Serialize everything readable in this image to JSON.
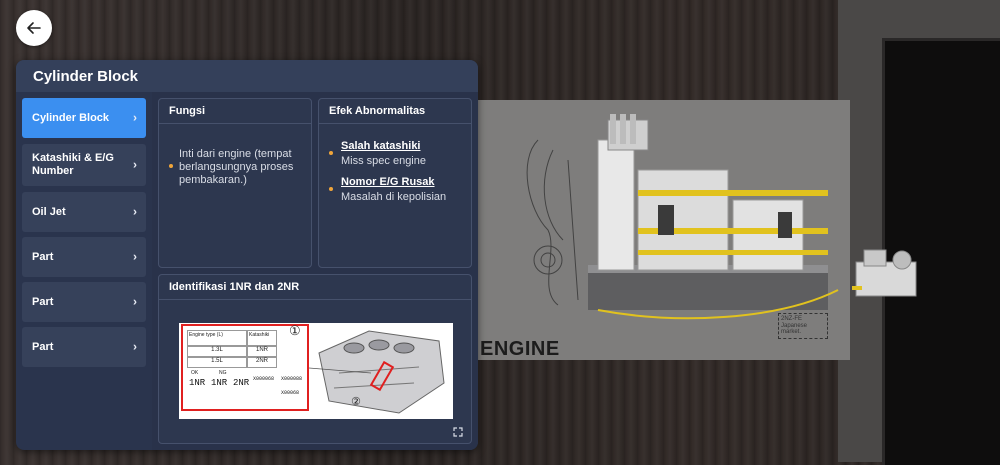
{
  "header": {
    "back_icon": "arrow-left-icon"
  },
  "panel": {
    "title": "Cylinder Block",
    "menu": [
      {
        "label": "Cylinder Block",
        "active": true
      },
      {
        "label": "Katashiki & E/G Number",
        "active": false
      },
      {
        "label": "Oil Jet",
        "active": false
      },
      {
        "label": "Part",
        "active": false
      },
      {
        "label": "Part",
        "active": false
      },
      {
        "label": "Part",
        "active": false
      }
    ],
    "fungsi": {
      "title": "Fungsi",
      "text": "Inti dari engine (tempat berlangsungnya proses pembakaran.)"
    },
    "efek": {
      "title": "Efek Abnormalitas",
      "items": [
        {
          "heading": "Salah katashiki",
          "desc": "Miss spec engine"
        },
        {
          "heading": "Nomor E/G Rusak",
          "desc": "Masalah di kepolisian"
        }
      ]
    },
    "identifikasi": {
      "title": "Identifikasi 1NR dan 2NR",
      "table": {
        "col1": "Engine type (L)",
        "col2": "Katashiki",
        "rows": [
          [
            "1.3L",
            "1NR"
          ],
          [
            "1.5L",
            "2NR"
          ]
        ],
        "marker1": "①",
        "marker2": "②",
        "ok_label": "OK",
        "ng_label": "NG",
        "engraved": [
          "1NR",
          "1NR",
          "2NR"
        ],
        "numbers": [
          "X000068",
          "X000088",
          "X00068"
        ]
      }
    }
  },
  "background": {
    "engine_label": "ENGINE",
    "caption": "2NZ-FE Japanese market."
  },
  "colors": {
    "accent": "#3b8ff0",
    "bullet": "#f0a53a",
    "panel": "#2a344d"
  }
}
